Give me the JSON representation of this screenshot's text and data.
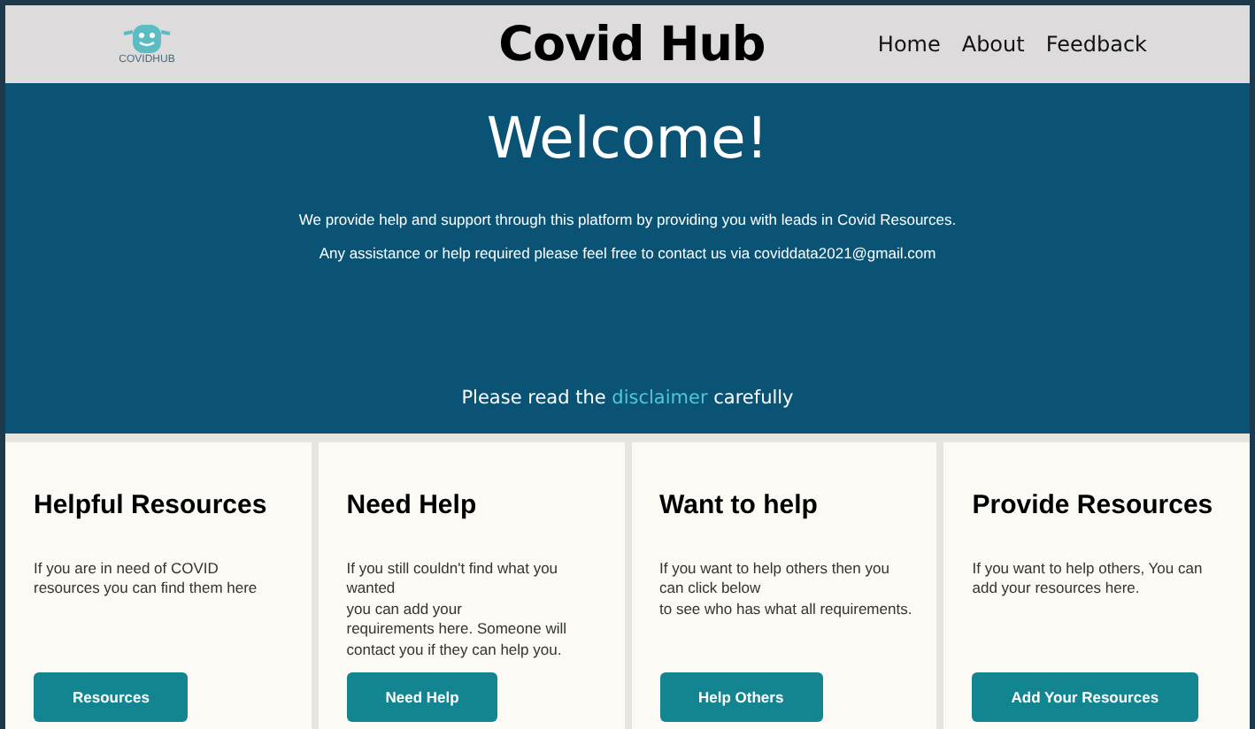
{
  "header": {
    "logo_text": "COVIDHUB",
    "title": "Covid Hub",
    "nav": [
      {
        "label": "Home"
      },
      {
        "label": "About"
      },
      {
        "label": "Feedback"
      }
    ]
  },
  "hero": {
    "heading": "Welcome!",
    "lines": [
      "We provide help and support through this platform by providing you with leads in Covid Resources.",
      "Any assistance or help required please feel free to contact us via coviddata2021@gmail.com"
    ],
    "notice": {
      "before": "Please read the",
      "link": "disclaimer",
      "after": "carefully"
    }
  },
  "cards": [
    {
      "title": "Helpful Resources",
      "lines": [
        "If you are in need of COVID resources you can find them here"
      ],
      "button": "Resources"
    },
    {
      "title": "Need Help",
      "lines": [
        "If you still couldn't find what you wanted",
        "you can add your",
        "requirements here. Someone will contact you if they can help you."
      ],
      "button": "Need Help"
    },
    {
      "title": "Want to help",
      "lines": [
        "If you want to help others then you can click below",
        "to see who has what all requirements."
      ],
      "button": "Help Others"
    },
    {
      "title": "Provide Resources",
      "lines": [
        "If you want to help others, You can add your resources here."
      ],
      "button": "Add Your Resources"
    }
  ]
}
